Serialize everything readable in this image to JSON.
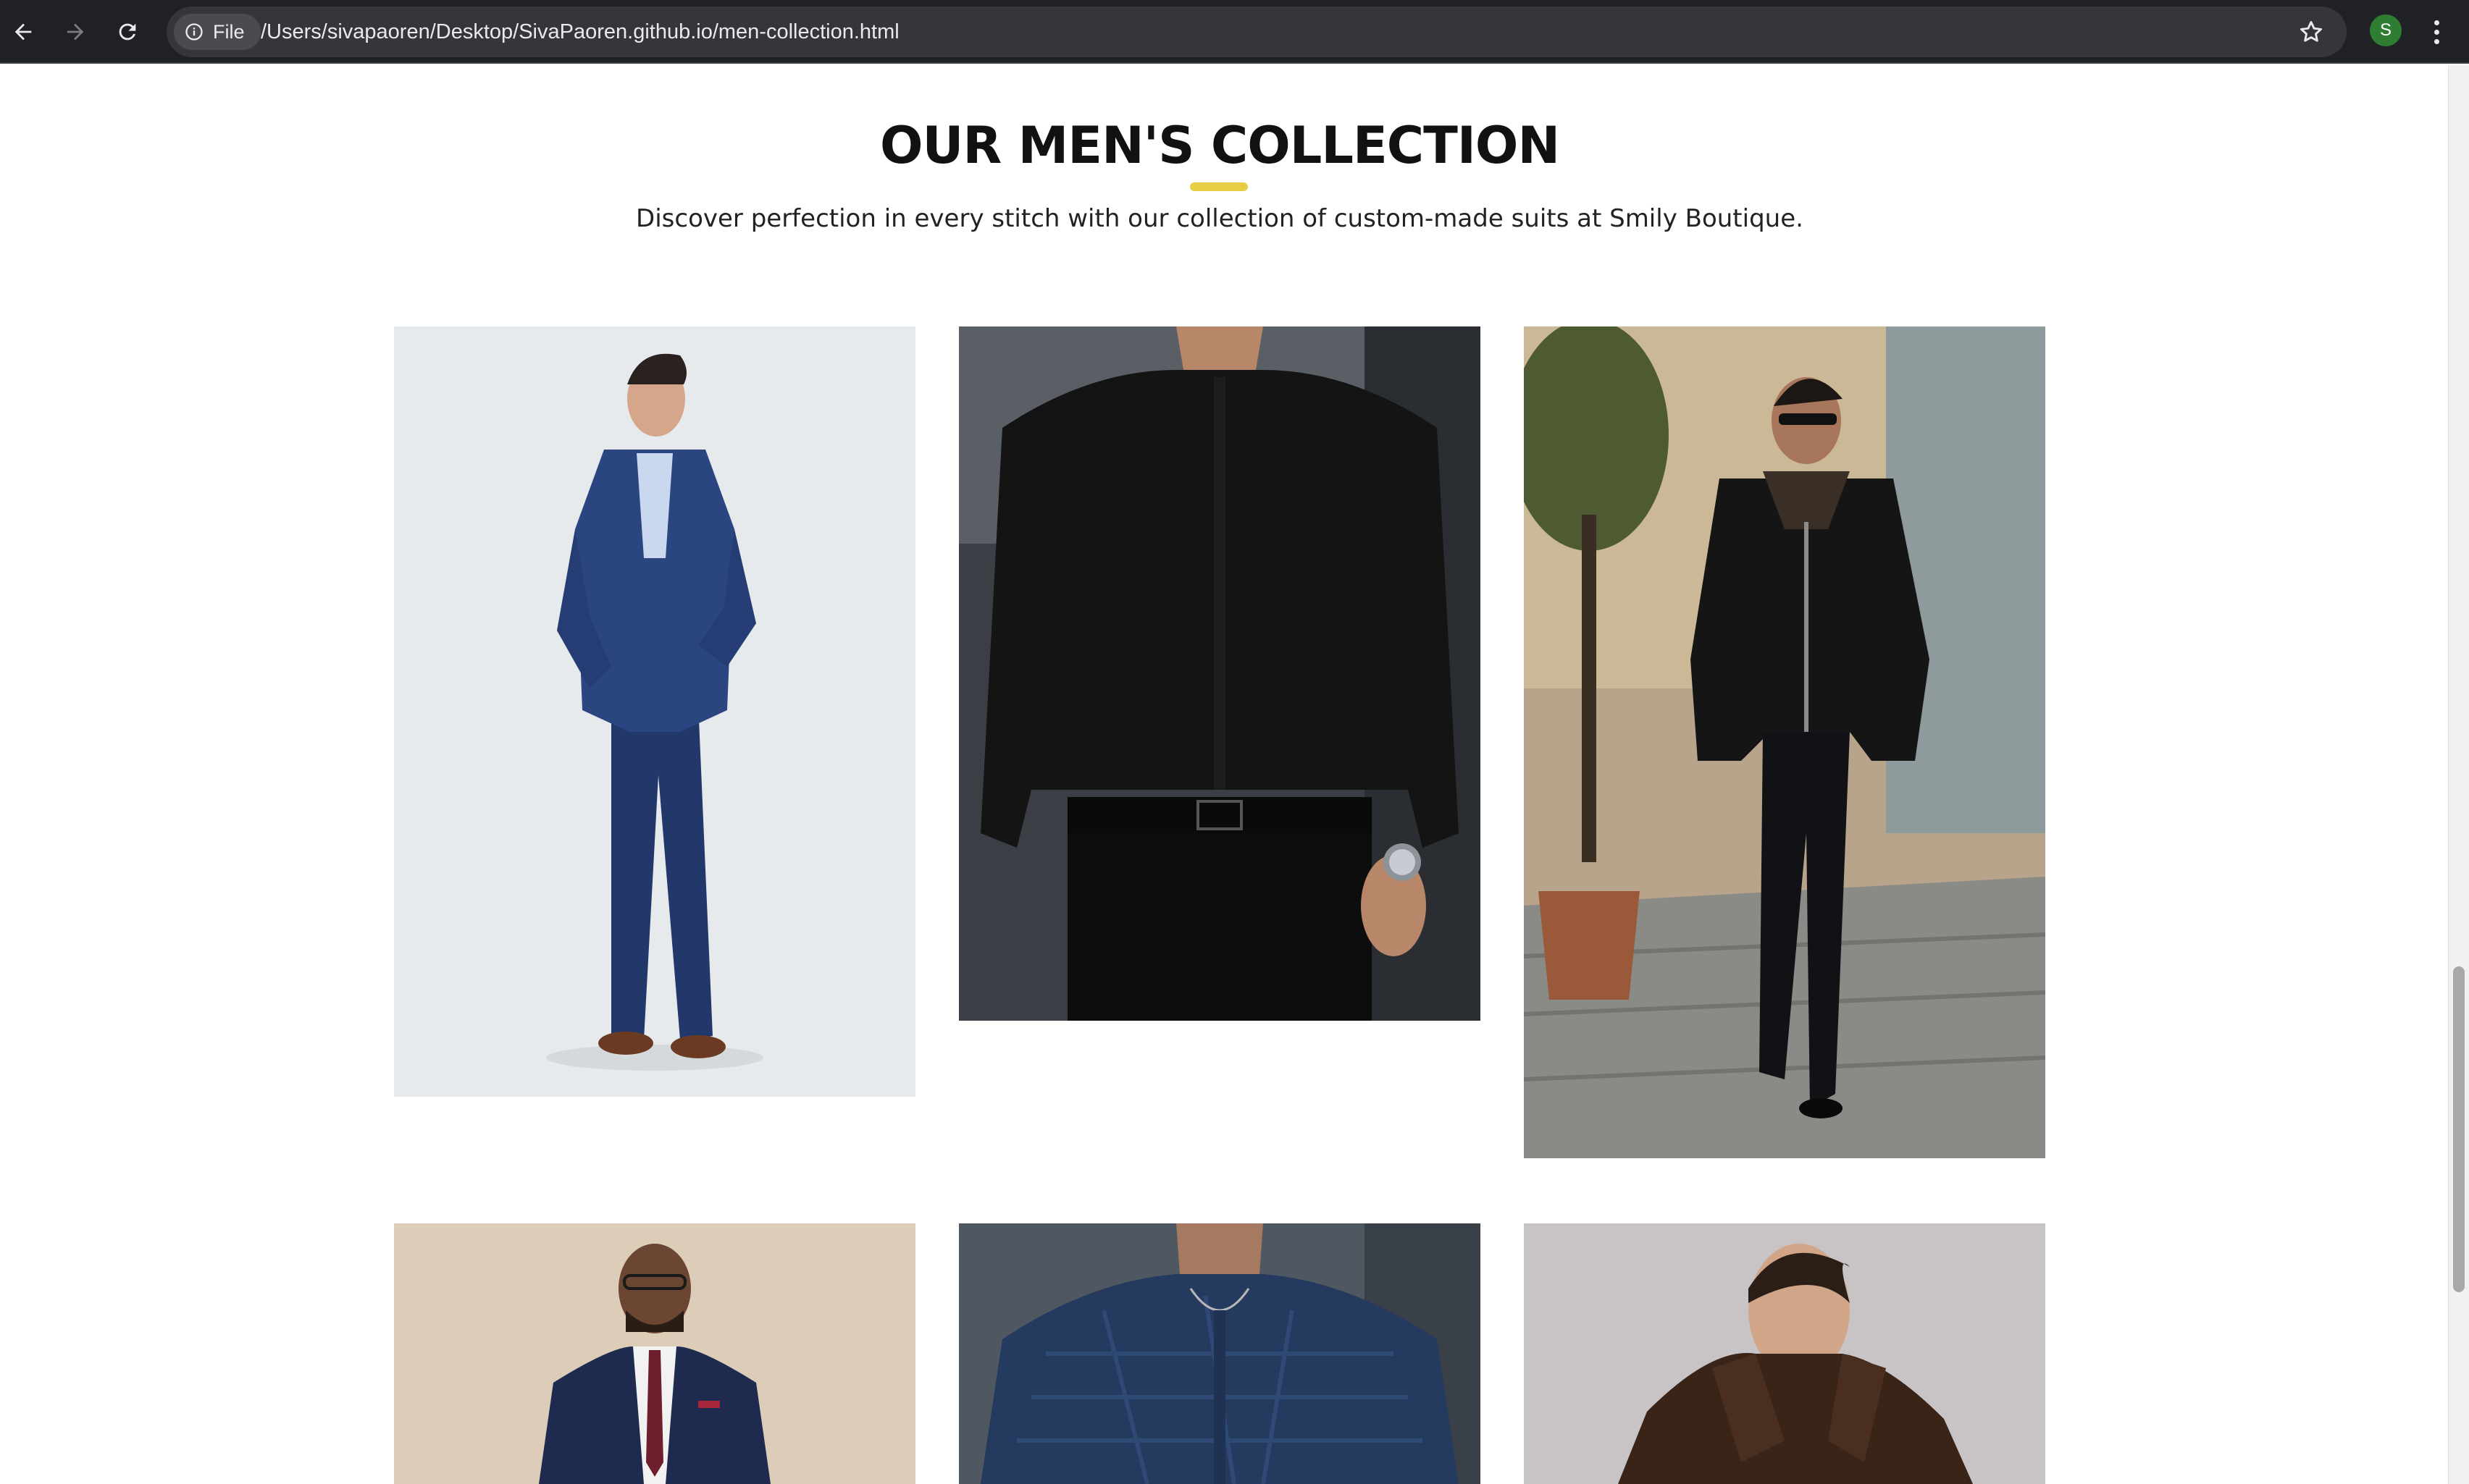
{
  "browser": {
    "site_info_label": "File",
    "url": "/Users/sivapaoren/Desktop/SivaPaoren.github.io/men-collection.html",
    "profile_initial": "S",
    "icons": [
      "back-arrow-icon",
      "forward-arrow-icon",
      "reload-icon",
      "info-icon",
      "bookmark-star-icon",
      "kebab-menu-icon"
    ]
  },
  "section": {
    "title": "OUR MEN'S COLLECTION",
    "subtitle": "Discover perfection in every stitch with our collection of custom-made suits at Smily Boutique.",
    "accent_color": "#e6cf45"
  },
  "products": [
    {
      "id": "navy-suit",
      "depicts": "Man in navy blue suit with brown shoes"
    },
    {
      "id": "black-shirt",
      "depicts": "Black dress shirt with black trousers and watch"
    },
    {
      "id": "leather-jacket",
      "depicts": "Man in black shearling leather jacket walking on street"
    },
    {
      "id": "three-piece-suit",
      "depicts": "Man in navy three-piece suit with burgundy tie"
    },
    {
      "id": "navy-patterned-shirt",
      "depicts": "Navy patterned shirt with necklace"
    },
    {
      "id": "brown-leather-jacket",
      "depicts": "Man in brown leather jacket"
    }
  ]
}
